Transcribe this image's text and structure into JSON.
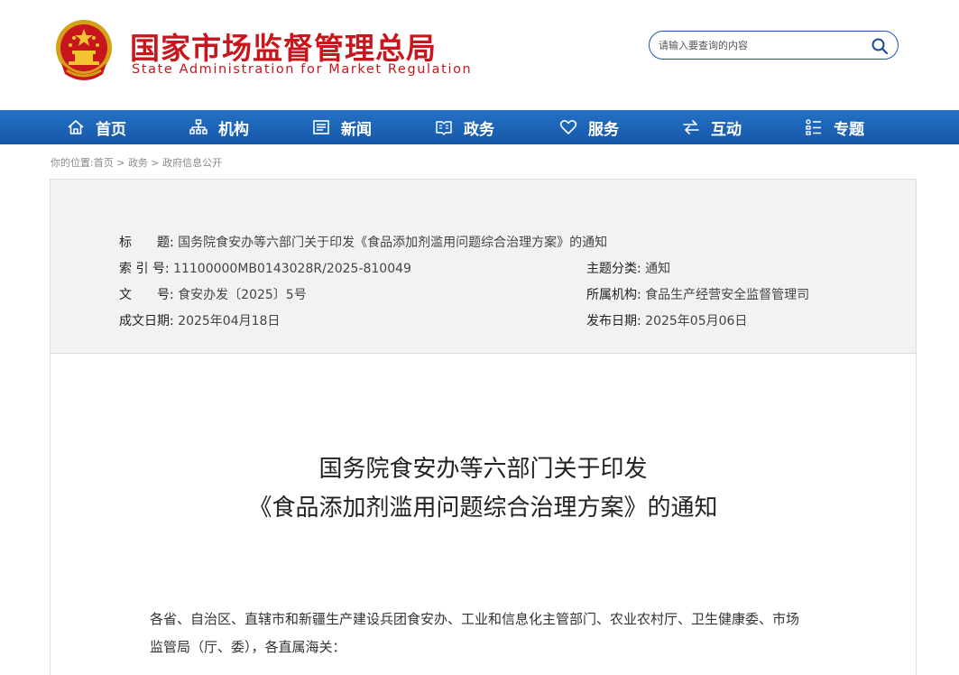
{
  "header": {
    "brand_cn": "国家市场监督管理总局",
    "brand_en": "State Administration for Market Regulation",
    "search_placeholder": "请输入要查询的内容",
    "brand_color": "#c8161d"
  },
  "nav": {
    "color": "#1a5fae",
    "items": [
      {
        "label": "首页",
        "icon": "home-icon"
      },
      {
        "label": "机构",
        "icon": "org-chart-icon"
      },
      {
        "label": "新闻",
        "icon": "news-icon"
      },
      {
        "label": "政务",
        "icon": "government-affairs-icon"
      },
      {
        "label": "服务",
        "icon": "heart-icon"
      },
      {
        "label": "互动",
        "icon": "exchange-arrows-icon"
      },
      {
        "label": "专题",
        "icon": "topic-list-icon"
      }
    ]
  },
  "breadcrumb": {
    "prefix": "你的位置:",
    "items": [
      "首页",
      "政务",
      "政府信息公开"
    ],
    "separator": " > "
  },
  "meta": {
    "title_label": "标　　题:",
    "title_value": "国务院食安办等六部门关于印发《食品添加剂滥用问题综合治理方案》的通知",
    "index_label": "索 引 号:",
    "index_value": "11100000MB0143028R/2025-810049",
    "topic_label": "主题分类:",
    "topic_value": "通知",
    "docno_label": "文　　号:",
    "docno_value": "食安办发〔2025〕5号",
    "org_label": "所属机构:",
    "org_value": "食品生产经营安全监督管理司",
    "date_label": "成文日期:",
    "date_value": "2025年04月18日",
    "pub_label": "发布日期:",
    "pub_value": "2025年05月06日"
  },
  "document": {
    "title_line1": "国务院食安办等六部门关于印发",
    "title_line2": "《食品添加剂滥用问题综合治理方案》的通知",
    "para1_line1": "各省、自治区、直辖市和新疆生产建设兵团食安办、工业和信息化主管部门、农业农村厅、卫生健康委、市场",
    "para1_line2": "监管局（厅、委），各直属海关："
  }
}
